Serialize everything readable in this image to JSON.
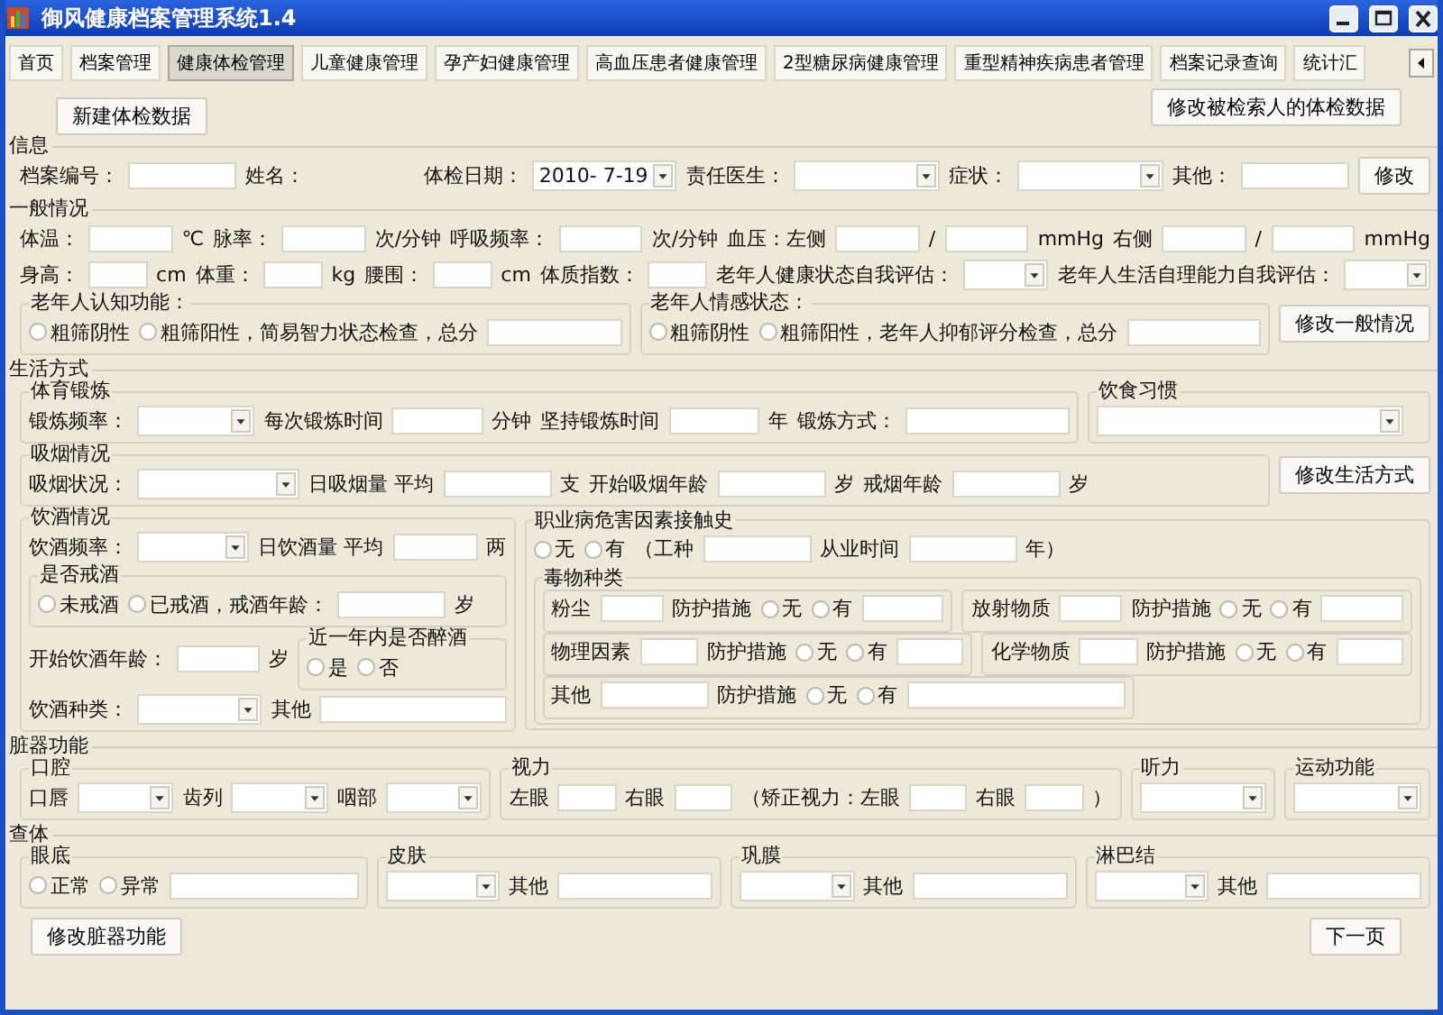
{
  "window": {
    "title": "御风健康档案管理系统1.4"
  },
  "tabs": [
    {
      "label": "首页",
      "selected": false
    },
    {
      "label": "档案管理",
      "selected": false
    },
    {
      "label": "健康体检管理",
      "selected": true
    },
    {
      "label": "儿童健康管理",
      "selected": false
    },
    {
      "label": "孕产妇健康管理",
      "selected": false
    },
    {
      "label": "高血压患者健康管理",
      "selected": false
    },
    {
      "label": "2型糖尿病健康管理",
      "selected": false
    },
    {
      "label": "重型精神疾病患者管理",
      "selected": false
    },
    {
      "label": "档案记录查询",
      "selected": false
    },
    {
      "label": "统计汇",
      "selected": false
    }
  ],
  "toolbar": {
    "new_button": "新建体检数据",
    "edit_button": "修改被检索人的体检数据"
  },
  "sections": [
    {
      "title": "信息",
      "lines": [
        {
          "fields": [
            {
              "kind": "text",
              "text": "档案编号："
            },
            {
              "kind": "input"
            },
            {
              "kind": "text",
              "text": "姓名："
            },
            {
              "kind": "gap"
            },
            {
              "kind": "text",
              "text": "体检日期："
            },
            {
              "kind": "date",
              "value": "2010- 7-19"
            },
            {
              "kind": "text",
              "text": "责任医生："
            },
            {
              "kind": "select"
            },
            {
              "kind": "text",
              "text": "症状："
            },
            {
              "kind": "select"
            },
            {
              "kind": "text",
              "text": "其他："
            },
            {
              "kind": "input"
            },
            {
              "kind": "button",
              "text": "修改"
            }
          ]
        }
      ]
    },
    {
      "title": "一般情况",
      "lines": [
        {
          "fields": [
            {
              "kind": "text",
              "text": "体温："
            },
            {
              "kind": "input"
            },
            {
              "kind": "text",
              "text": "℃"
            },
            {
              "kind": "text",
              "text": "脉率："
            },
            {
              "kind": "input"
            },
            {
              "kind": "text",
              "text": "次/分钟"
            },
            {
              "kind": "text",
              "text": "呼吸频率："
            },
            {
              "kind": "input"
            },
            {
              "kind": "text",
              "text": "次/分钟"
            },
            {
              "kind": "text",
              "text": "血压：左侧"
            },
            {
              "kind": "input"
            },
            {
              "kind": "text",
              "text": "/"
            },
            {
              "kind": "input"
            },
            {
              "kind": "text",
              "text": "mmHg"
            },
            {
              "kind": "text",
              "text": "右侧"
            },
            {
              "kind": "input"
            },
            {
              "kind": "text",
              "text": "/"
            },
            {
              "kind": "input"
            },
            {
              "kind": "text",
              "text": "mmHg"
            }
          ]
        },
        {
          "fields": [
            {
              "kind": "text",
              "text": "身高："
            },
            {
              "kind": "input"
            },
            {
              "kind": "text",
              "text": "cm"
            },
            {
              "kind": "text",
              "text": "体重："
            },
            {
              "kind": "input"
            },
            {
              "kind": "text",
              "text": "kg"
            },
            {
              "kind": "text",
              "text": "腰围："
            },
            {
              "kind": "input"
            },
            {
              "kind": "text",
              "text": "cm"
            },
            {
              "kind": "text",
              "text": "体质指数："
            },
            {
              "kind": "input"
            },
            {
              "kind": "text",
              "text": "老年人健康状态自我评估："
            },
            {
              "kind": "select"
            },
            {
              "kind": "text",
              "text": "老年人生活自理能力自我评估："
            },
            {
              "kind": "select"
            }
          ]
        },
        {
          "fields": [
            {
              "kind": "group",
              "title": "老年人认知功能：",
              "lines": [
                {
                  "fields": [
                    {
                      "kind": "radio",
                      "text": "粗筛阴性",
                      "selected": false
                    },
                    {
                      "kind": "radio",
                      "text": "粗筛阳性，简易智力状态检查，总分",
                      "selected": false
                    },
                    {
                      "kind": "input"
                    }
                  ]
                }
              ]
            },
            {
              "kind": "group",
              "title": "老年人情感状态：",
              "lines": [
                {
                  "fields": [
                    {
                      "kind": "radio",
                      "text": "粗筛阴性",
                      "selected": false
                    },
                    {
                      "kind": "radio",
                      "text": "粗筛阳性，老年人抑郁评分检查，总分",
                      "selected": false
                    },
                    {
                      "kind": "input"
                    }
                  ]
                }
              ]
            },
            {
              "kind": "button",
              "text": "修改一般情况"
            }
          ]
        }
      ]
    },
    {
      "title": "生活方式",
      "lines": [
        {
          "fields": [
            {
              "kind": "group",
              "title": "体育锻炼",
              "lines": [
                {
                  "fields": [
                    {
                      "kind": "text",
                      "text": "锻炼频率："
                    },
                    {
                      "kind": "select"
                    },
                    {
                      "kind": "text",
                      "text": "每次锻炼时间"
                    },
                    {
                      "kind": "input"
                    },
                    {
                      "kind": "text",
                      "text": "分钟"
                    },
                    {
                      "kind": "text",
                      "text": "坚持锻炼时间"
                    },
                    {
                      "kind": "input"
                    },
                    {
                      "kind": "text",
                      "text": "年"
                    },
                    {
                      "kind": "text",
                      "text": "锻炼方式："
                    },
                    {
                      "kind": "input"
                    }
                  ]
                }
              ]
            },
            {
              "kind": "group",
              "title": "饮食习惯",
              "lines": [
                {
                  "fields": [
                    {
                      "kind": "select"
                    }
                  ]
                }
              ]
            }
          ]
        },
        {
          "fields": [
            {
              "kind": "group",
              "title": "吸烟情况",
              "lines": [
                {
                  "fields": [
                    {
                      "kind": "text",
                      "text": "吸烟状况："
                    },
                    {
                      "kind": "select"
                    },
                    {
                      "kind": "text",
                      "text": "日吸烟量 平均"
                    },
                    {
                      "kind": "input"
                    },
                    {
                      "kind": "text",
                      "text": "支"
                    },
                    {
                      "kind": "text",
                      "text": "开始吸烟年龄"
                    },
                    {
                      "kind": "input"
                    },
                    {
                      "kind": "text",
                      "text": "岁"
                    },
                    {
                      "kind": "text",
                      "text": "戒烟年龄"
                    },
                    {
                      "kind": "input"
                    },
                    {
                      "kind": "text",
                      "text": "岁"
                    }
                  ]
                }
              ]
            },
            {
              "kind": "button",
              "text": "修改生活方式"
            }
          ]
        },
        {
          "fields": [
            {
              "kind": "group",
              "title": "饮酒情况",
              "lines": [
                {
                  "fields": [
                    {
                      "kind": "text",
                      "text": "饮酒频率："
                    },
                    {
                      "kind": "select"
                    },
                    {
                      "kind": "text",
                      "text": "日饮酒量 平均"
                    },
                    {
                      "kind": "input"
                    },
                    {
                      "kind": "text",
                      "text": "两"
                    }
                  ]
                },
                {
                  "fields": [
                    {
                      "kind": "group",
                      "title": "是否戒酒",
                      "lines": [
                        {
                          "fields": [
                            {
                              "kind": "radio",
                              "text": "未戒酒",
                              "selected": false
                            },
                            {
                              "kind": "radio",
                              "text": "已戒酒，戒酒年龄：",
                              "selected": false
                            },
                            {
                              "kind": "input"
                            },
                            {
                              "kind": "text",
                              "text": "岁"
                            }
                          ]
                        }
                      ]
                    }
                  ]
                },
                {
                  "fields": [
                    {
                      "kind": "text",
                      "text": "开始饮酒年龄："
                    },
                    {
                      "kind": "input"
                    },
                    {
                      "kind": "text",
                      "text": "岁"
                    },
                    {
                      "kind": "group",
                      "title": "近一年内是否醉酒",
                      "lines": [
                        {
                          "fields": [
                            {
                              "kind": "radio",
                              "text": "是",
                              "selected": false
                            },
                            {
                              "kind": "radio",
                              "text": "否",
                              "selected": false
                            }
                          ]
                        }
                      ]
                    }
                  ]
                },
                {
                  "fields": [
                    {
                      "kind": "text",
                      "text": "饮酒种类："
                    },
                    {
                      "kind": "select"
                    },
                    {
                      "kind": "text",
                      "text": "其他"
                    },
                    {
                      "kind": "input"
                    }
                  ]
                }
              ]
            },
            {
              "kind": "group",
              "title": "职业病危害因素接触史",
              "lines": [
                {
                  "fields": [
                    {
                      "kind": "radio",
                      "text": "无",
                      "selected": false
                    },
                    {
                      "kind": "radio",
                      "text": "有",
                      "selected": false
                    },
                    {
                      "kind": "text",
                      "text": "（工种"
                    },
                    {
                      "kind": "input"
                    },
                    {
                      "kind": "text",
                      "text": "从业时间"
                    },
                    {
                      "kind": "input"
                    },
                    {
                      "kind": "text",
                      "text": "年）"
                    }
                  ]
                },
                {
                  "fields": [
                    {
                      "kind": "group",
                      "title": "毒物种类",
                      "lines": [
                        {
                          "fields": [
                            {
                              "kind": "group",
                              "lines": [
                                {
                                  "fields": [
                                    {
                                      "kind": "text",
                                      "text": "粉尘"
                                    },
                                    {
                                      "kind": "input"
                                    },
                                    {
                                      "kind": "text",
                                      "text": "防护措施"
                                    },
                                    {
                                      "kind": "radio",
                                      "text": "无",
                                      "selected": false
                                    },
                                    {
                                      "kind": "radio",
                                      "text": "有",
                                      "selected": false
                                    },
                                    {
                                      "kind": "input"
                                    }
                                  ]
                                }
                              ]
                            },
                            {
                              "kind": "group",
                              "lines": [
                                {
                                  "fields": [
                                    {
                                      "kind": "text",
                                      "text": "放射物质"
                                    },
                                    {
                                      "kind": "input"
                                    },
                                    {
                                      "kind": "text",
                                      "text": "防护措施"
                                    },
                                    {
                                      "kind": "radio",
                                      "text": "无",
                                      "selected": false
                                    },
                                    {
                                      "kind": "radio",
                                      "text": "有",
                                      "selected": false
                                    },
                                    {
                                      "kind": "input"
                                    }
                                  ]
                                }
                              ]
                            }
                          ]
                        },
                        {
                          "fields": [
                            {
                              "kind": "group",
                              "lines": [
                                {
                                  "fields": [
                                    {
                                      "kind": "text",
                                      "text": "物理因素"
                                    },
                                    {
                                      "kind": "input"
                                    },
                                    {
                                      "kind": "text",
                                      "text": "防护措施"
                                    },
                                    {
                                      "kind": "radio",
                                      "text": "无",
                                      "selected": false
                                    },
                                    {
                                      "kind": "radio",
                                      "text": "有",
                                      "selected": false
                                    },
                                    {
                                      "kind": "input"
                                    }
                                  ]
                                }
                              ]
                            },
                            {
                              "kind": "group",
                              "lines": [
                                {
                                  "fields": [
                                    {
                                      "kind": "text",
                                      "text": "化学物质"
                                    },
                                    {
                                      "kind": "input"
                                    },
                                    {
                                      "kind": "text",
                                      "text": "防护措施"
                                    },
                                    {
                                      "kind": "radio",
                                      "text": "无",
                                      "selected": false
                                    },
                                    {
                                      "kind": "radio",
                                      "text": "有",
                                      "selected": false
                                    },
                                    {
                                      "kind": "input"
                                    }
                                  ]
                                }
                              ]
                            }
                          ]
                        },
                        {
                          "fields": [
                            {
                              "kind": "group",
                              "lines": [
                                {
                                  "fields": [
                                    {
                                      "kind": "text",
                                      "text": "其他"
                                    },
                                    {
                                      "kind": "input"
                                    },
                                    {
                                      "kind": "text",
                                      "text": "防护措施"
                                    },
                                    {
                                      "kind": "radio",
                                      "text": "无",
                                      "selected": false
                                    },
                                    {
                                      "kind": "radio",
                                      "text": "有",
                                      "selected": false
                                    },
                                    {
                                      "kind": "input"
                                    }
                                  ]
                                }
                              ]
                            },
                            {
                              "kind": "gap"
                            }
                          ]
                        }
                      ]
                    }
                  ]
                }
              ]
            }
          ]
        }
      ]
    },
    {
      "title": "脏器功能",
      "lines": [
        {
          "fields": [
            {
              "kind": "group",
              "title": "口腔",
              "lines": [
                {
                  "fields": [
                    {
                      "kind": "text",
                      "text": "口唇"
                    },
                    {
                      "kind": "select"
                    },
                    {
                      "kind": "text",
                      "text": "齿列"
                    },
                    {
                      "kind": "select"
                    },
                    {
                      "kind": "text",
                      "text": "咽部"
                    },
                    {
                      "kind": "select"
                    }
                  ]
                }
              ]
            },
            {
              "kind": "group",
              "title": "视力",
              "lines": [
                {
                  "fields": [
                    {
                      "kind": "text",
                      "text": "左眼"
                    },
                    {
                      "kind": "input"
                    },
                    {
                      "kind": "text",
                      "text": "右眼"
                    },
                    {
                      "kind": "input"
                    },
                    {
                      "kind": "text",
                      "text": "（矫正视力：左眼"
                    },
                    {
                      "kind": "input"
                    },
                    {
                      "kind": "text",
                      "text": "右眼"
                    },
                    {
                      "kind": "input"
                    },
                    {
                      "kind": "text",
                      "text": "）"
                    }
                  ]
                }
              ]
            },
            {
              "kind": "group",
              "title": "听力",
              "lines": [
                {
                  "fields": [
                    {
                      "kind": "select"
                    }
                  ]
                }
              ]
            },
            {
              "kind": "group",
              "title": "运动功能",
              "lines": [
                {
                  "fields": [
                    {
                      "kind": "select"
                    }
                  ]
                }
              ]
            }
          ]
        }
      ]
    },
    {
      "title": "查体",
      "lines": [
        {
          "fields": [
            {
              "kind": "group",
              "title": "眼底",
              "lines": [
                {
                  "fields": [
                    {
                      "kind": "radio",
                      "text": "正常",
                      "selected": false
                    },
                    {
                      "kind": "radio",
                      "text": "异常",
                      "selected": false
                    },
                    {
                      "kind": "input"
                    }
                  ]
                }
              ]
            },
            {
              "kind": "group",
              "title": "皮肤",
              "lines": [
                {
                  "fields": [
                    {
                      "kind": "select"
                    },
                    {
                      "kind": "text",
                      "text": "其他"
                    },
                    {
                      "kind": "input"
                    }
                  ]
                }
              ]
            },
            {
              "kind": "group",
              "title": "巩膜",
              "lines": [
                {
                  "fields": [
                    {
                      "kind": "select"
                    },
                    {
                      "kind": "text",
                      "text": "其他"
                    },
                    {
                      "kind": "input"
                    }
                  ]
                }
              ]
            },
            {
              "kind": "group",
              "title": "淋巴结",
              "lines": [
                {
                  "fields": [
                    {
                      "kind": "select"
                    },
                    {
                      "kind": "text",
                      "text": "其他"
                    },
                    {
                      "kind": "input"
                    }
                  ]
                }
              ]
            }
          ]
        }
      ]
    }
  ],
  "footer": {
    "organ_button": "修改脏器功能",
    "next_button": "下一页"
  }
}
